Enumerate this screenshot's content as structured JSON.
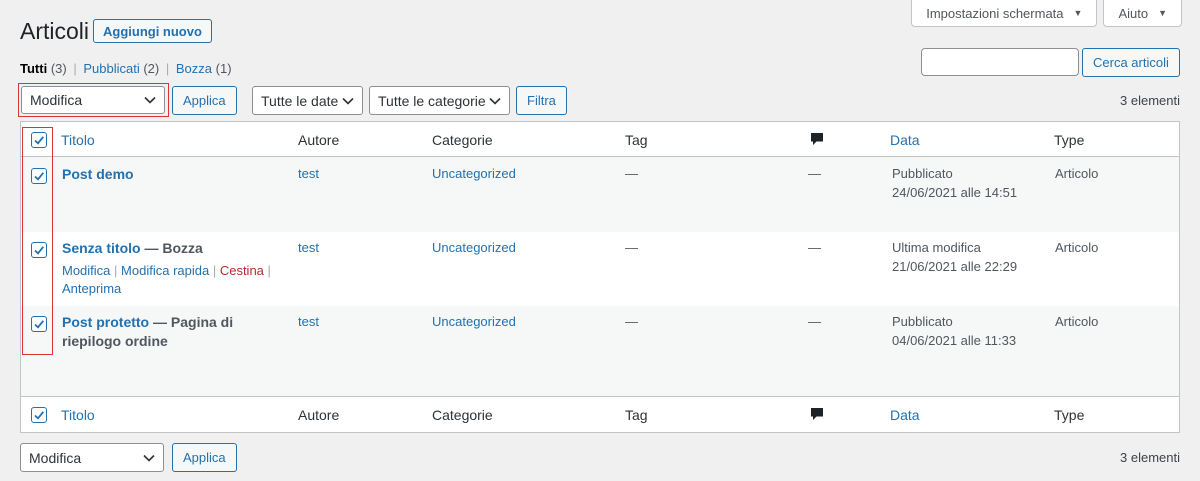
{
  "screen_meta": {
    "options_label": "Impostazioni schermata",
    "help_label": "Aiuto"
  },
  "header": {
    "title": "Articoli",
    "add_new_label": "Aggiungi nuovo"
  },
  "views": [
    {
      "label": "Tutti",
      "count": "(3)"
    },
    {
      "label": "Pubblicati",
      "count": "(2)"
    },
    {
      "label": "Bozza",
      "count": "(1)"
    }
  ],
  "search": {
    "value": "",
    "button_label": "Cerca articoli"
  },
  "bulk_actions": {
    "selected": "Modifica",
    "apply_label": "Applica"
  },
  "filters": {
    "dates_selected": "Tutte le date",
    "categories_selected": "Tutte le categorie",
    "filter_label": "Filtra"
  },
  "items_count": "3 elementi",
  "columns": {
    "title": "Titolo",
    "author": "Autore",
    "categories": "Categorie",
    "tags": "Tag",
    "date": "Data",
    "type": "Type"
  },
  "rows": [
    {
      "title": "Post demo",
      "state": "",
      "author": "test",
      "category": "Uncategorized",
      "tags": "—",
      "comments": "—",
      "date_status": "Pubblicato",
      "date_value": "24/06/2021 alle 14:51",
      "type": "Articolo",
      "checked": true
    },
    {
      "title": "Senza titolo",
      "state": " — Bozza",
      "author": "test",
      "category": "Uncategorized",
      "tags": "—",
      "comments": "—",
      "date_status": "Ultima modifica",
      "date_value": "21/06/2021 alle 22:29",
      "type": "Articolo",
      "checked": true,
      "actions": {
        "edit": "Modifica",
        "quick_edit": "Modifica rapida",
        "trash": "Cestina",
        "preview": "Anteprima"
      }
    },
    {
      "title": "Post protetto",
      "state": " — Pagina di",
      "state_line2": "riepilogo ordine",
      "author": "test",
      "category": "Uncategorized",
      "tags": "—",
      "comments": "—",
      "date_status": "Pubblicato",
      "date_value": "04/06/2021 alle 11:33",
      "type": "Articolo",
      "checked": true
    }
  ],
  "colors": {
    "link": "#2271b1",
    "highlight": "#d63638",
    "trash": "#b32d2e",
    "background": "#f0f0f1"
  }
}
